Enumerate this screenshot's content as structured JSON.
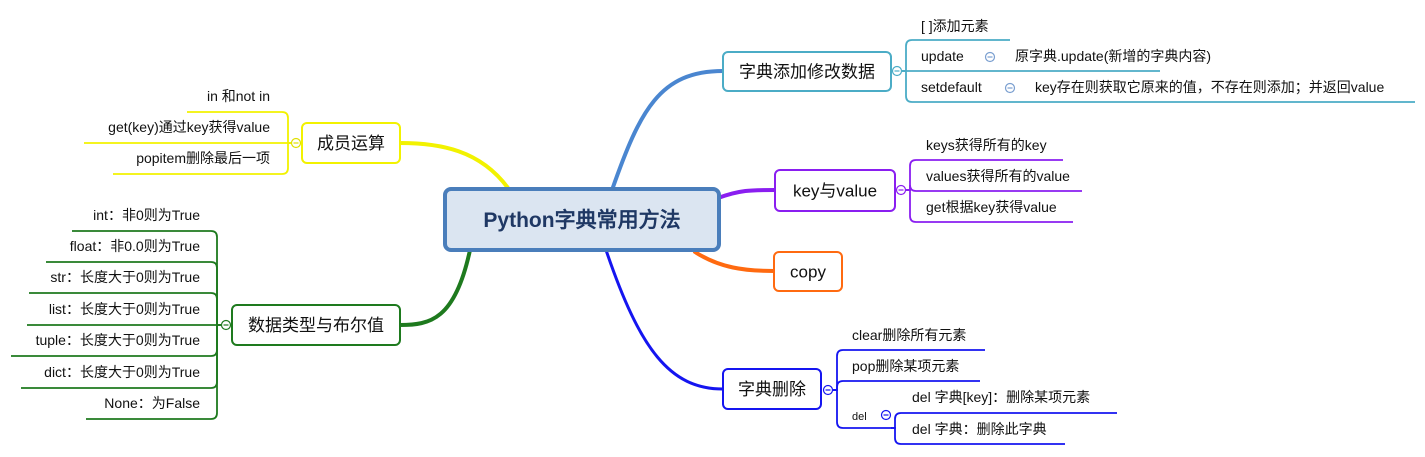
{
  "central": {
    "label": "Python字典常用方法"
  },
  "colors": {
    "central_fill": "#dbe5f1",
    "central_border": "#4a7ebb",
    "add": "#4bacc6",
    "add_curve": "#4a86d0",
    "keyvalue": "#8a1ef0",
    "copy": "#ff6a10",
    "delete": "#1515f0",
    "member": "#f2f200",
    "bool": "#1e7a1e"
  },
  "branches": {
    "add": {
      "label": "字典添加修改数据",
      "children": [
        {
          "label": "[ ]添加元素"
        },
        {
          "label": "update",
          "detail": "原字典.update(新增的字典内容)"
        },
        {
          "label": "setdefault",
          "detail": "key存在则获取它原来的值，不存在则添加；并返回value"
        }
      ]
    },
    "keyvalue": {
      "label": "key与value",
      "children": [
        {
          "label": "keys获得所有的key"
        },
        {
          "label": "values获得所有的value"
        },
        {
          "label": "get根据key获得value"
        }
      ]
    },
    "copy": {
      "label": "copy"
    },
    "delete": {
      "label": "字典删除",
      "children": [
        {
          "label": "clear删除所有元素"
        },
        {
          "label": "pop删除某项元素"
        },
        {
          "label": "del",
          "children": [
            {
              "label": "del 字典[key]：删除某项元素"
            },
            {
              "label": "del 字典：删除此字典"
            }
          ]
        }
      ]
    },
    "member": {
      "label": "成员运算",
      "children": [
        {
          "label": "in 和not in"
        },
        {
          "label": "get(key)通过key获得value"
        },
        {
          "label": "popitem删除最后一项"
        }
      ]
    },
    "bool": {
      "label": "数据类型与布尔值",
      "children": [
        {
          "label": "int：非0则为True"
        },
        {
          "label": "float：非0.0则为True"
        },
        {
          "label": "str：长度大于0则为True"
        },
        {
          "label": "list：长度大于0则为True"
        },
        {
          "label": "tuple：长度大于0则为True"
        },
        {
          "label": "dict：长度大于0则为True"
        },
        {
          "label": "None：为False"
        }
      ]
    }
  },
  "icons": {
    "collapse": "circle-minus-icon"
  }
}
